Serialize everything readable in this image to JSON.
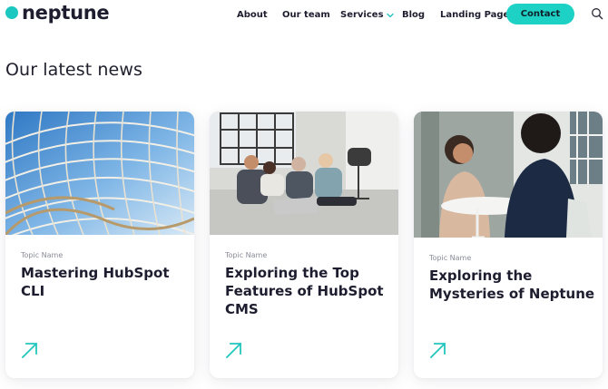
{
  "brand": {
    "name": "neptune",
    "accent": "#1ed1c5"
  },
  "nav": {
    "items": [
      {
        "label": "About"
      },
      {
        "label": "Our team"
      },
      {
        "label": "Services",
        "icon": "chevron-down-icon"
      },
      {
        "label": "Blog"
      },
      {
        "label": "Landing Page"
      }
    ],
    "contact_label": "Contact",
    "search_icon": "search-icon"
  },
  "main": {
    "title": "Our latest news",
    "cards": [
      {
        "topic": "Topic Name",
        "title": "Mastering HubSpot CLI",
        "image": "glass-dome-architecture",
        "arrow_icon": "arrow-up-right-icon"
      },
      {
        "topic": "Topic Name",
        "title": "Exploring the Top Features of HubSpot CMS",
        "image": "team-working-on-floor",
        "arrow_icon": "arrow-up-right-icon"
      },
      {
        "topic": "Topic Name",
        "title": "Exploring the Mysteries of Neptune",
        "image": "two-women-meeting",
        "arrow_icon": "arrow-up-right-icon"
      }
    ]
  }
}
